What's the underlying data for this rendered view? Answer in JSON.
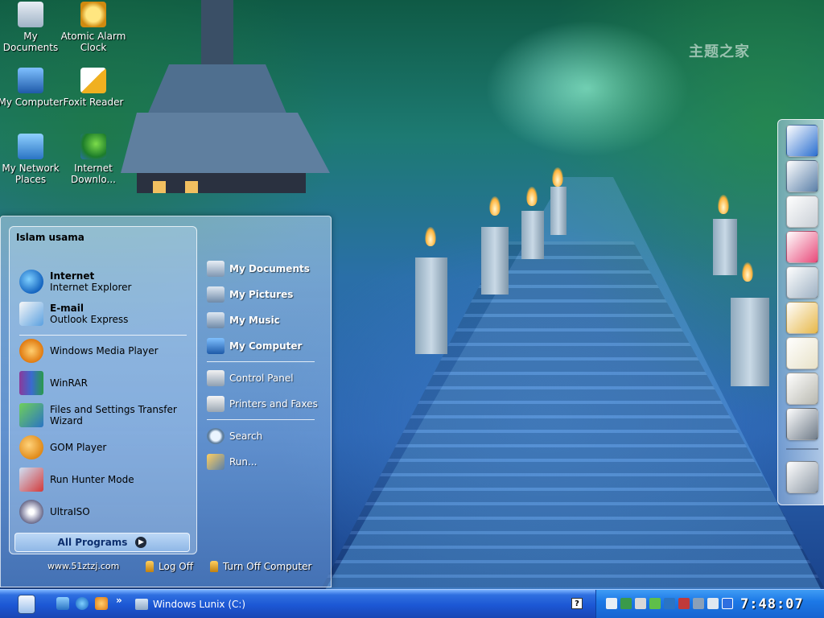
{
  "watermark": "主题之家",
  "desktop": {
    "icons": [
      {
        "label": "My Documents",
        "icon": "printer-icon"
      },
      {
        "label": "Atomic Alarm Clock",
        "icon": "alarm-clock-icon"
      },
      {
        "label": "My Computer",
        "icon": "computer-icon"
      },
      {
        "label": "Foxit Reader",
        "icon": "foxit-reader-icon"
      },
      {
        "label": "My Network Places",
        "icon": "network-icon"
      },
      {
        "label": "Internet Downlo...",
        "icon": "internet-download-manager-icon"
      }
    ]
  },
  "start_menu": {
    "user_name": "Islam usama",
    "pinned": [
      {
        "title": "Internet",
        "subtitle": "Internet Explorer",
        "icon": "internet-explorer-icon"
      },
      {
        "title": "E-mail",
        "subtitle": "Outlook Express",
        "icon": "outlook-express-icon"
      }
    ],
    "recent": [
      {
        "label": "Windows Media Player",
        "icon": "windows-media-player-icon"
      },
      {
        "label": "WinRAR",
        "icon": "winrar-icon"
      },
      {
        "label": "Files and Settings Transfer Wizard",
        "icon": "transfer-wizard-icon"
      },
      {
        "label": "GOM Player",
        "icon": "gom-player-icon"
      },
      {
        "label": "Run Hunter Mode",
        "icon": "hunter-mode-icon"
      },
      {
        "label": "UltraISO",
        "icon": "ultraiso-icon"
      }
    ],
    "all_programs_label": "All Programs",
    "places": [
      {
        "label": "My Documents",
        "icon": "documents-folder-icon"
      },
      {
        "label": "My Pictures",
        "icon": "pictures-folder-icon"
      },
      {
        "label": "My Music",
        "icon": "music-folder-icon"
      },
      {
        "label": "My Computer",
        "icon": "computer-icon"
      }
    ],
    "system": [
      {
        "label": "Control Panel",
        "icon": "control-panel-icon"
      },
      {
        "label": "Printers and Faxes",
        "icon": "printer-icon"
      }
    ],
    "tools": [
      {
        "label": "Search",
        "icon": "search-icon"
      },
      {
        "label": "Run...",
        "icon": "run-icon"
      }
    ],
    "footer": {
      "url": "www.51ztzj.com",
      "log_off": "Log Off",
      "turn_off": "Turn Off Computer"
    }
  },
  "dock": {
    "items": [
      {
        "icon": "launcher-a-icon",
        "color": "#2a6fd0"
      },
      {
        "icon": "drawing-tablet-icon",
        "color": "#5a7fa8"
      },
      {
        "icon": "gears-icon",
        "color": "#c9cfd6"
      },
      {
        "icon": "color-wheel-icon",
        "color": "#e84a7a"
      },
      {
        "icon": "globe-icon",
        "color": "#9fb2c4"
      },
      {
        "icon": "paint-palette-icon",
        "color": "#e7b84a"
      },
      {
        "icon": "notepad-icon",
        "color": "#e8e2c8"
      },
      {
        "icon": "calculator-icon",
        "color": "#b9b9b0"
      },
      {
        "icon": "settings-tools-icon",
        "color": "#6f7b88"
      },
      {
        "icon": "trash-icon",
        "color": "#8f9aa6"
      }
    ]
  },
  "taskbar": {
    "task_label": "Windows Lunix (C:)",
    "chevron": "»",
    "help_glyph": "?",
    "clock": "7:48:07"
  }
}
